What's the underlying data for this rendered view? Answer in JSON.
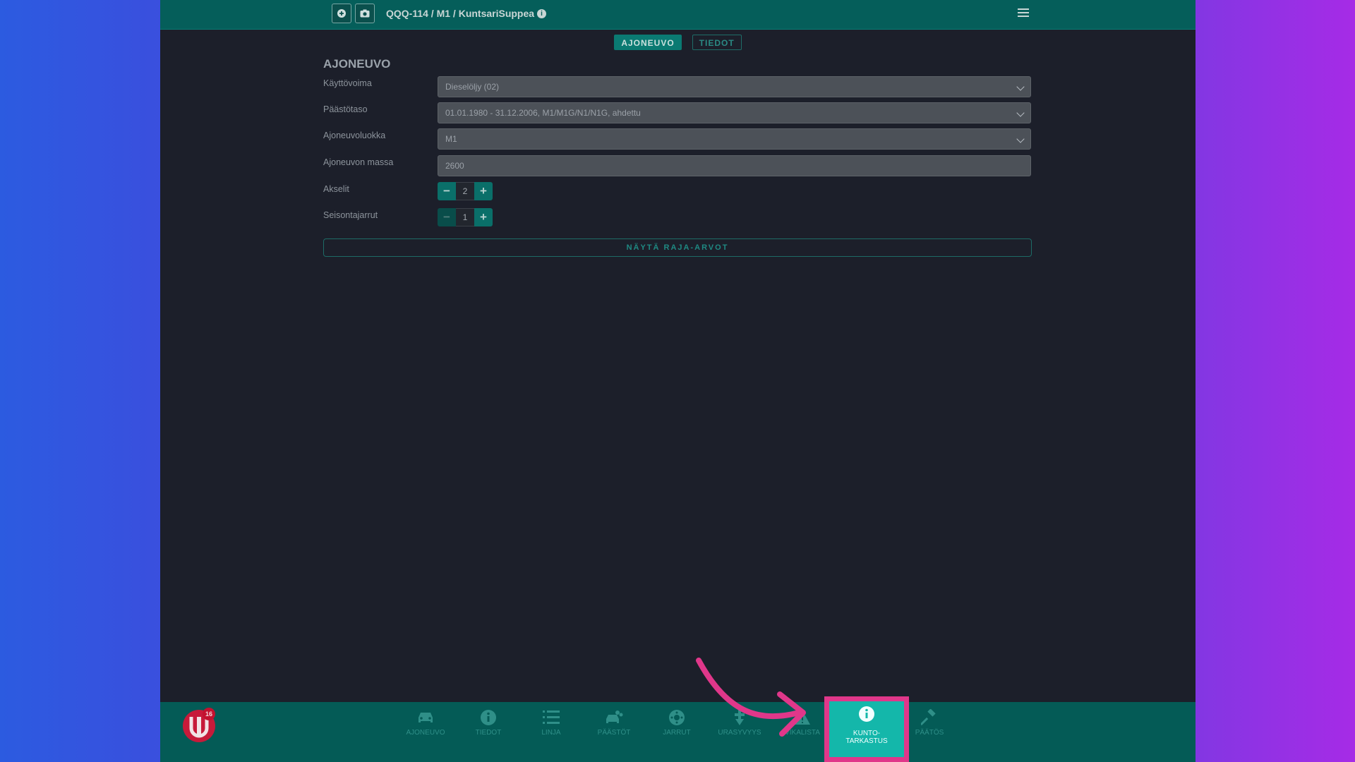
{
  "header": {
    "breadcrumb": "QQQ-114 / M1 / KuntsariSuppea",
    "buttons": [
      {
        "icon": "circle-plus-icon"
      },
      {
        "icon": "camera-icon"
      }
    ],
    "menu_icon": "hamburger-menu-icon"
  },
  "tabs": [
    {
      "label": "AJONEUVO",
      "active": true
    },
    {
      "label": "TIEDOT",
      "active": false
    }
  ],
  "section": {
    "title": "AJONEUVO"
  },
  "form": {
    "kayttovoima": {
      "label": "Käyttövoima",
      "value": "Dieselöljy (02)"
    },
    "paastotaso": {
      "label": "Päästötaso",
      "value": "01.01.1980 - 31.12.2006, M1/M1G/N1/N1G, ahdettu"
    },
    "ajoneuvoluokka": {
      "label": "Ajoneuvoluokka",
      "value": "M1"
    },
    "massa": {
      "label": "Ajoneuvon massa",
      "value": "2600"
    },
    "akselit": {
      "label": "Akselit",
      "value": "2"
    },
    "seisontajarrut": {
      "label": "Seisontajarrut",
      "value": "1"
    }
  },
  "limits_button": "NÄYTÄ RAJA-ARVOT",
  "nav": {
    "badge": "16",
    "items": [
      {
        "label": "AJONEUVO",
        "icon": "car-icon"
      },
      {
        "label": "TIEDOT",
        "icon": "info-icon"
      },
      {
        "label": "LINJA",
        "icon": "list-icon"
      },
      {
        "label": "PÄÄSTÖT",
        "icon": "exhaust-icon"
      },
      {
        "label": "JARRUT",
        "icon": "brake-icon"
      },
      {
        "label": "URASYVYYS",
        "icon": "tread-depth-icon"
      },
      {
        "label": "VIKALISTA",
        "icon": "warning-icon"
      },
      {
        "label_line1": "KUNTO-",
        "label_line2": "TARKASTUS",
        "icon": "info-icon",
        "active": true
      },
      {
        "label": "PÄÄTÖS",
        "icon": "gavel-icon"
      }
    ]
  },
  "colors": {
    "accent": "#0a7a72",
    "highlight": "#e0378a",
    "active_nav": "#14b7aa"
  }
}
